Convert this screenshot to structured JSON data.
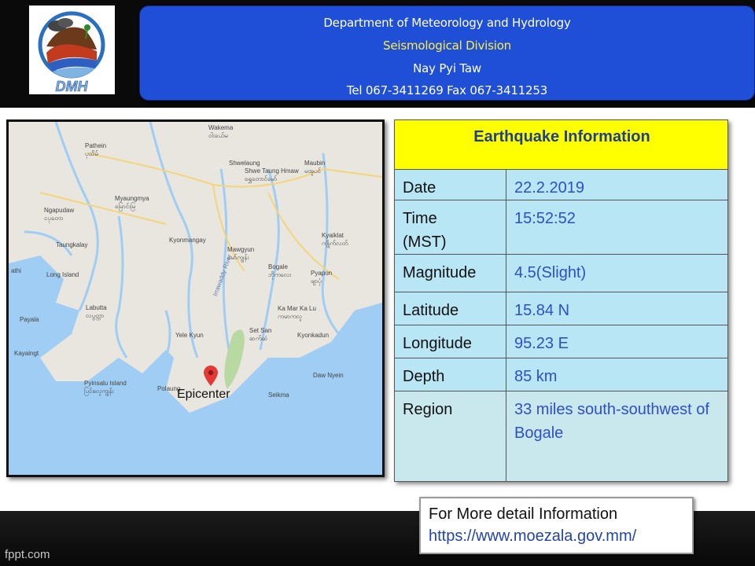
{
  "header": {
    "logo_text": "DMH",
    "department": "Department of Meteorology and Hydrology",
    "division": "Seismological Division",
    "city": "Nay Pyi Taw",
    "contact": "Tel 067-3411269 Fax 067-3411253"
  },
  "map": {
    "marker_label": "Epicenter",
    "places": [
      {
        "name": "Pathein",
        "local": "ပုသိမ်"
      },
      {
        "name": "Wakema",
        "local": "ဝါးခယ်မ"
      },
      {
        "name": "Shwelaung",
        "local": ""
      },
      {
        "name": "Shwe Taung Hmaw",
        "local": "ရွှေတောင်မော်"
      },
      {
        "name": "Maubin",
        "local": "မအူပင်"
      },
      {
        "name": "Myaungmya",
        "local": "မြောင်းမြ"
      },
      {
        "name": "Ngapudaw",
        "local": "ငပုတော"
      },
      {
        "name": "Kyonmangay",
        "local": ""
      },
      {
        "name": "Mawgyun",
        "local": "မော်ကျွန်း"
      },
      {
        "name": "Kyaiklat",
        "local": "ကျိုက်လတ်"
      },
      {
        "name": "Taungkalay",
        "local": ""
      },
      {
        "name": "Long Island",
        "local": ""
      },
      {
        "name": "Bogale",
        "local": "ဘိုကလေး"
      },
      {
        "name": "Pyapon",
        "local": "ဖျာပုံ"
      },
      {
        "name": "Labutta",
        "local": "လပွတ္တာ"
      },
      {
        "name": "Ka Mar Ka Lu",
        "local": "ကမာကလူ"
      },
      {
        "name": "Payala",
        "local": ""
      },
      {
        "name": "Set San",
        "local": "ဆက်ဆံ"
      },
      {
        "name": "Yele Kyun",
        "local": ""
      },
      {
        "name": "Kyonkadun",
        "local": ""
      },
      {
        "name": "Kayaingt",
        "local": ""
      },
      {
        "name": "Pyinsalu Island",
        "local": "ပြင်စလူကျွန်း"
      },
      {
        "name": "Polaung",
        "local": ""
      },
      {
        "name": "Daw Nyein",
        "local": ""
      },
      {
        "name": "Seikma",
        "local": ""
      },
      {
        "name": "Irrawaddy River",
        "local": ""
      },
      {
        "name": "athi",
        "local": ""
      }
    ]
  },
  "info": {
    "title": "Earthquake Information",
    "rows": [
      {
        "key": "Date",
        "value": "22.2.2019"
      },
      {
        "key": "Time\n(MST)",
        "value": "15:52:52"
      },
      {
        "key": "Magnitude",
        "value": "4.5(Slight)"
      },
      {
        "key": "Latitude",
        "value": "15.84 N"
      },
      {
        "key": "Longitude",
        "value": "95.23 E"
      },
      {
        "key": "Depth",
        "value": "85 km"
      },
      {
        "key": "Region",
        "value": "33 miles south-southwest of Bogale"
      }
    ]
  },
  "more_info": {
    "label": "For More detail Information",
    "url": "https://www.moezala.gov.mm/"
  },
  "footer": {
    "brand": "fppt.com"
  },
  "colors": {
    "banner": "#1f4fd6",
    "banner_highlight": "#ffee44",
    "table_header": "#ffff00",
    "table_cell": "#b9e6f5",
    "value_text": "#2e4fc9",
    "water": "#9fcdf3",
    "marker": "#e53935"
  }
}
